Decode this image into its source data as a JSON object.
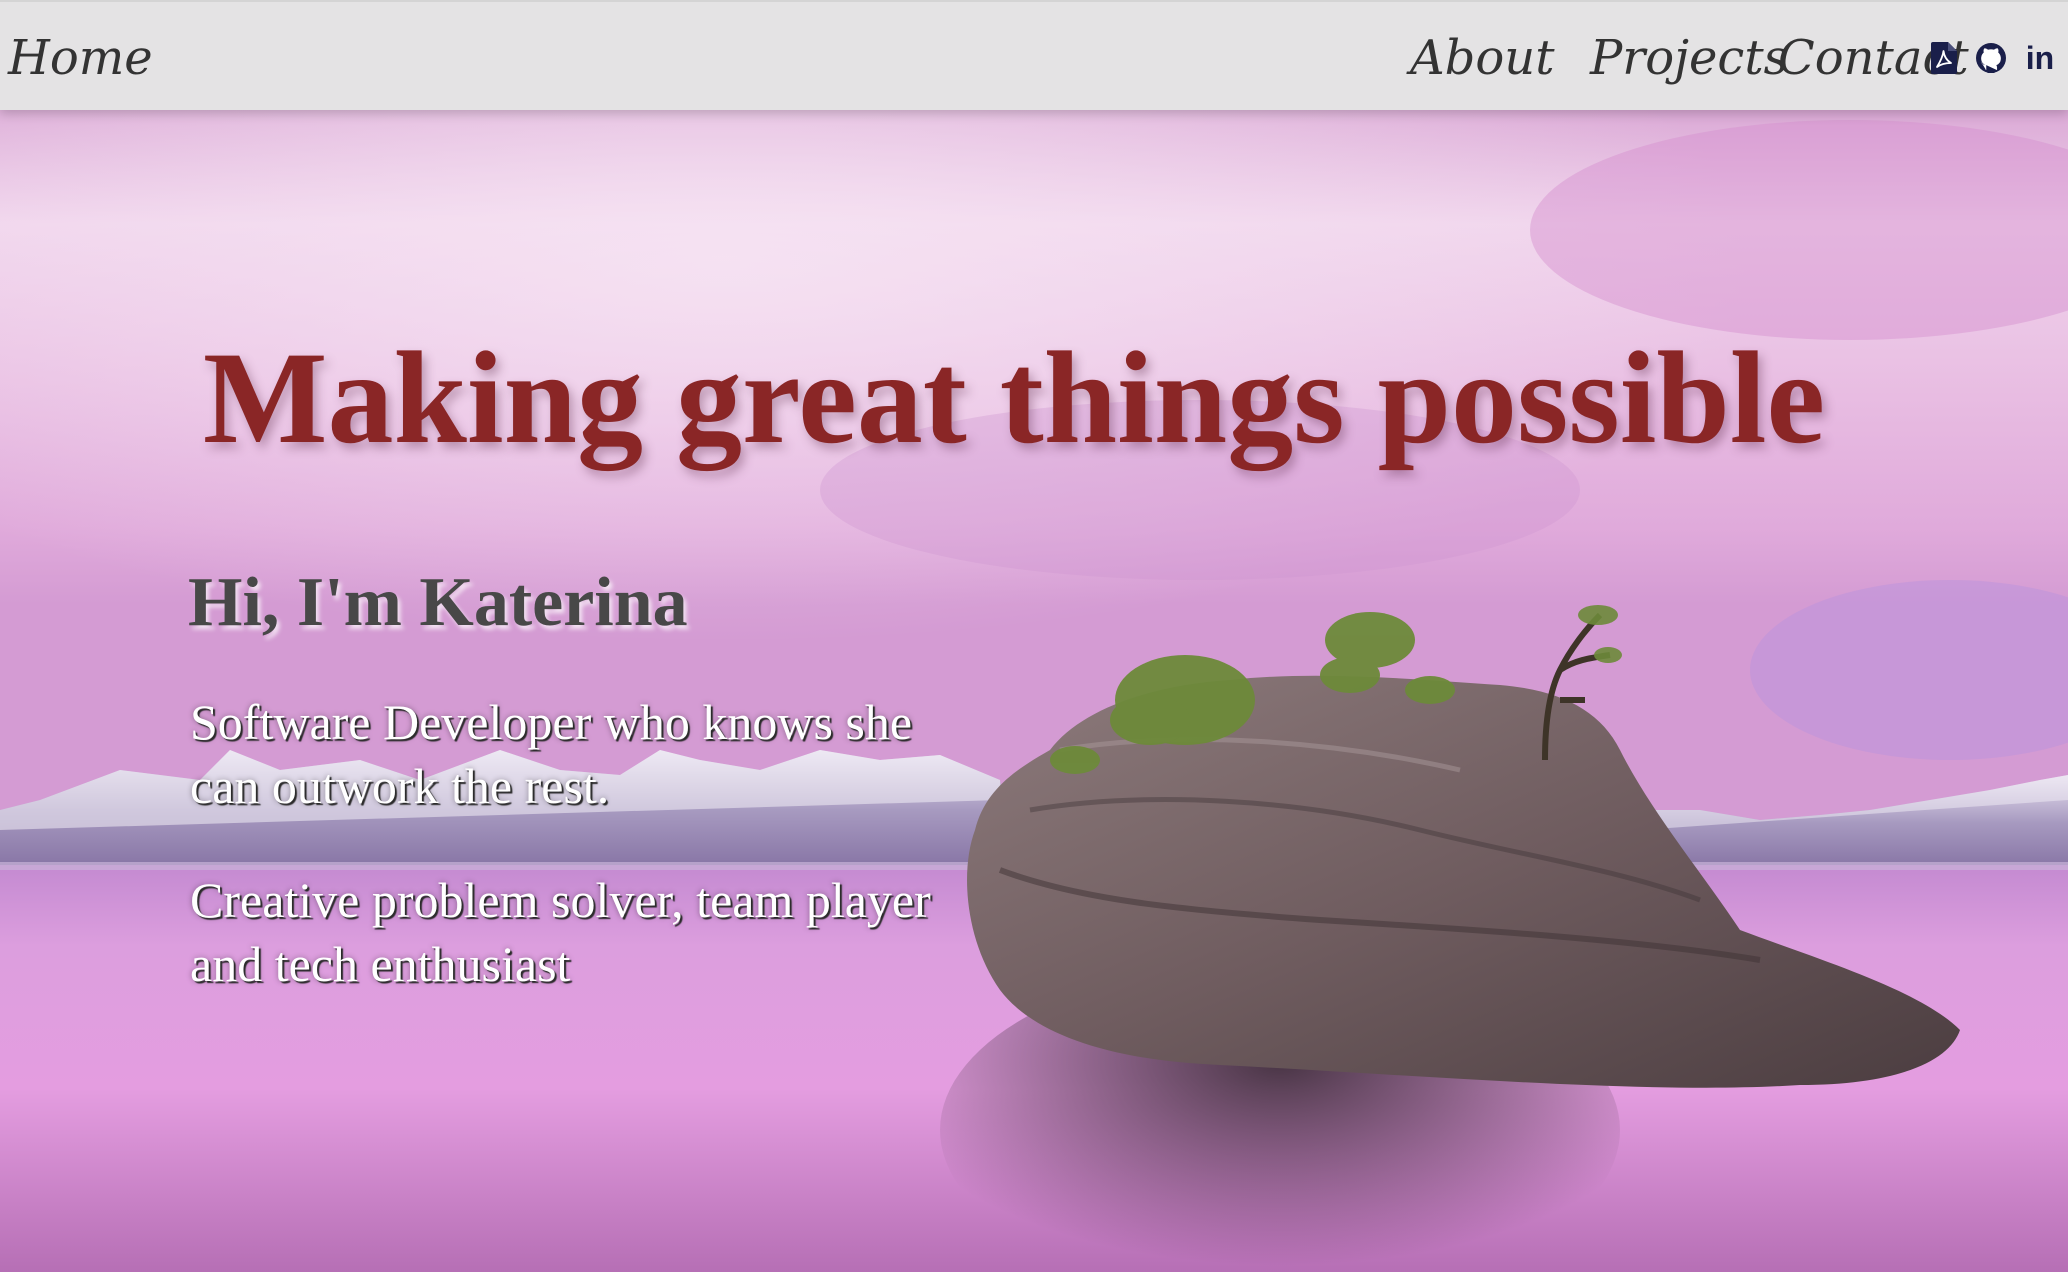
{
  "nav": {
    "home_label": "Home",
    "links": [
      {
        "label": "About"
      },
      {
        "label": "Projects"
      },
      {
        "label": "Contact"
      }
    ],
    "icons": [
      "pdf-icon",
      "github-icon",
      "linkedin-icon"
    ],
    "linkedin_glyph": "in",
    "background": "#e4e3e4",
    "text_color": "#333333",
    "icon_color": "#1a1f4a"
  },
  "hero": {
    "headline": "Making great things possible",
    "greeting": "Hi, I'm Katerina",
    "tagline_line1": "Software Developer who knows she can outwork the rest.",
    "tagline_line2": "Creative problem solver, team player and tech enthusiast",
    "headline_color": "#8a2626",
    "greeting_color": "#484848",
    "tagline_color": "#ffffff",
    "sky_color": "#e6b2de",
    "water_color": "#d98ad0"
  }
}
